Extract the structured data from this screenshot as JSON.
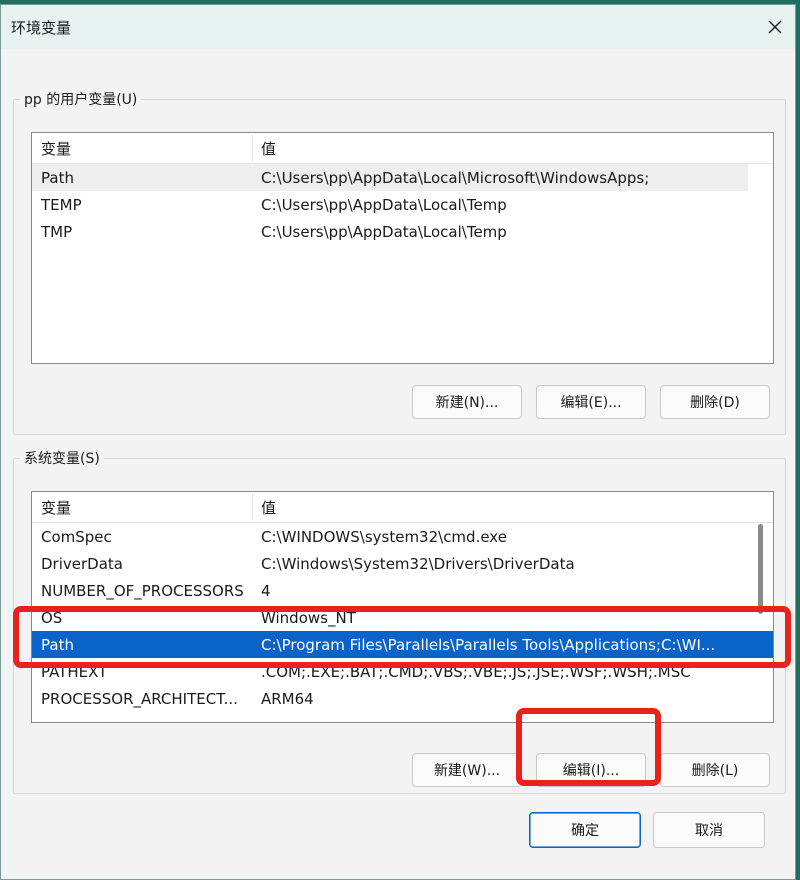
{
  "window": {
    "title": "环境变量",
    "close_icon": "close-icon"
  },
  "user_vars": {
    "legend": "pp 的用户变量(U)",
    "columns": [
      "变量",
      "值"
    ],
    "rows": [
      {
        "name": "Path",
        "value": "C:\\Users\\pp\\AppData\\Local\\Microsoft\\WindowsApps;"
      },
      {
        "name": "TEMP",
        "value": "C:\\Users\\pp\\AppData\\Local\\Temp"
      },
      {
        "name": "TMP",
        "value": "C:\\Users\\pp\\AppData\\Local\\Temp"
      }
    ],
    "buttons": {
      "new": "新建(N)...",
      "edit": "编辑(E)...",
      "delete": "删除(D)"
    }
  },
  "system_vars": {
    "legend": "系统变量(S)",
    "columns": [
      "变量",
      "值"
    ],
    "rows": [
      {
        "name": "ComSpec",
        "value": "C:\\WINDOWS\\system32\\cmd.exe"
      },
      {
        "name": "DriverData",
        "value": "C:\\Windows\\System32\\Drivers\\DriverData"
      },
      {
        "name": "NUMBER_OF_PROCESSORS",
        "value": "4"
      },
      {
        "name": "OS",
        "value": "Windows_NT"
      },
      {
        "name": "Path",
        "value": "C:\\Program Files\\Parallels\\Parallels Tools\\Applications;C:\\WI..."
      },
      {
        "name": "PATHEXT",
        "value": ".COM;.EXE;.BAT;.CMD;.VBS;.VBE;.JS;.JSE;.WSF;.WSH;.MSC"
      },
      {
        "name": "PROCESSOR_ARCHITECT...",
        "value": "ARM64"
      }
    ],
    "buttons": {
      "new": "新建(W)...",
      "edit": "编辑(I)...",
      "delete": "删除(L)"
    }
  },
  "footer": {
    "ok": "确定",
    "cancel": "取消"
  },
  "colors": {
    "selection": "#0a63c9",
    "highlight": "#e8231b"
  }
}
